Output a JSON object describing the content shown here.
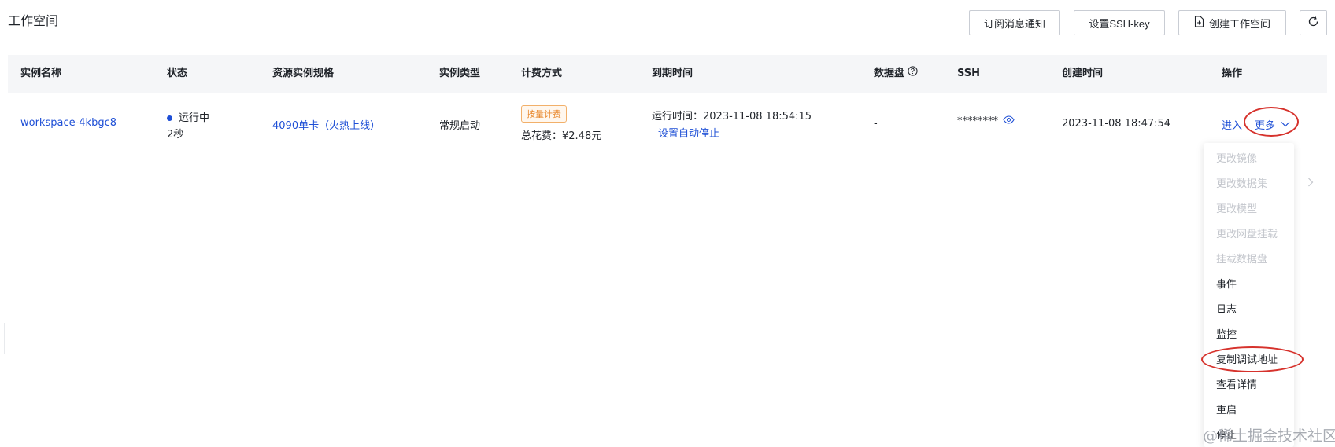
{
  "header": {
    "title": "工作空间",
    "subscribe_label": "订阅消息通知",
    "ssh_key_label": "设置SSH-key",
    "create_label": "创建工作空间"
  },
  "table": {
    "columns": [
      "实例名称",
      "状态",
      "资源实例规格",
      "实例类型",
      "计费方式",
      "到期时间",
      "数据盘",
      "SSH",
      "创建时间",
      "操作"
    ],
    "rows": [
      {
        "name": "workspace-4kbgc8",
        "status": "运行中",
        "duration": "2秒",
        "spec": "4090单卡（火热上线）",
        "type": "常规启动",
        "billing_tag": "按量计费",
        "total_cost": "总花费：¥2.48元",
        "run_time": "运行时间：2023-11-08 18:54:15",
        "auto_stop": "设置自动停止",
        "data_disk": "-",
        "ssh": "********",
        "created": "2023-11-08 18:47:54",
        "enter": "进入",
        "more": "更多"
      }
    ]
  },
  "dropdown": {
    "items": [
      {
        "label": "更改镜像",
        "disabled": true
      },
      {
        "label": "更改数据集",
        "disabled": true
      },
      {
        "label": "更改模型",
        "disabled": true
      },
      {
        "label": "更改网盘挂载",
        "disabled": true
      },
      {
        "label": "挂载数据盘",
        "disabled": true
      },
      {
        "label": "事件",
        "disabled": false
      },
      {
        "label": "日志",
        "disabled": false
      },
      {
        "label": "监控",
        "disabled": false
      },
      {
        "label": "复制调试地址",
        "disabled": false
      },
      {
        "label": "查看详情",
        "disabled": false
      },
      {
        "label": "重启",
        "disabled": false
      },
      {
        "label": "停止",
        "disabled": false
      }
    ]
  },
  "watermark": "@稀土掘金技术社区",
  "colors": {
    "link": "#1e4fd6",
    "highlight": "#d6322c",
    "tag": "#e8892f"
  }
}
